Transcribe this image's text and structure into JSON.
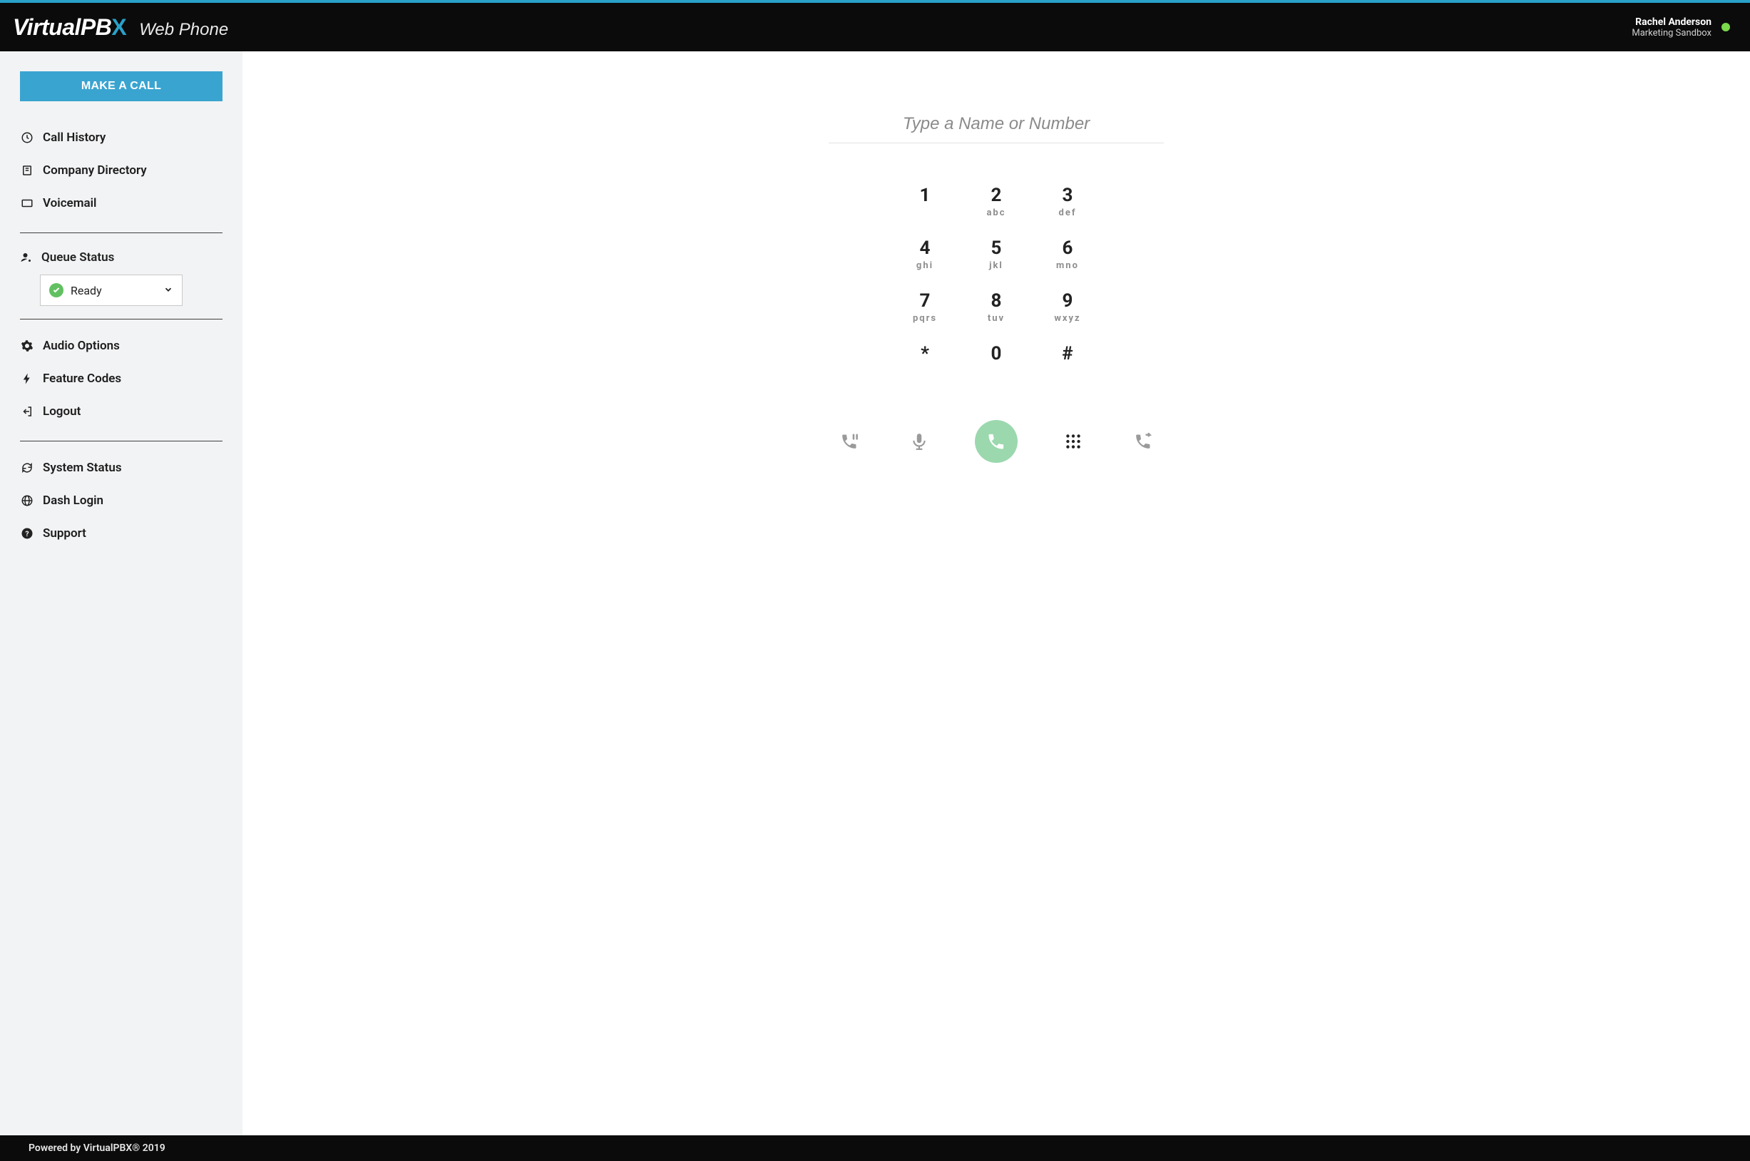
{
  "header": {
    "brand": "VirtualPBX",
    "subtitle": "Web Phone",
    "user_name": "Rachel Anderson",
    "user_org": "Marketing Sandbox",
    "presence_color": "#7bd94a"
  },
  "sidebar": {
    "make_call_label": "MAKE A CALL",
    "nav_primary": [
      {
        "id": "call-history",
        "label": "Call History",
        "icon": "clock-icon"
      },
      {
        "id": "company-directory",
        "label": "Company Directory",
        "icon": "book-icon"
      },
      {
        "id": "voicemail",
        "label": "Voicemail",
        "icon": "voicemail-icon"
      }
    ],
    "queue": {
      "label": "Queue Status",
      "selected": "Ready"
    },
    "nav_secondary": [
      {
        "id": "audio-options",
        "label": "Audio Options",
        "icon": "gear-icon"
      },
      {
        "id": "feature-codes",
        "label": "Feature Codes",
        "icon": "bolt-icon"
      },
      {
        "id": "logout",
        "label": "Logout",
        "icon": "logout-icon"
      }
    ],
    "nav_tertiary": [
      {
        "id": "system-status",
        "label": "System Status",
        "icon": "refresh-icon"
      },
      {
        "id": "dash-login",
        "label": "Dash Login",
        "icon": "globe-icon"
      },
      {
        "id": "support",
        "label": "Support",
        "icon": "help-icon"
      }
    ]
  },
  "dialer": {
    "placeholder": "Type a Name or Number",
    "value": "",
    "keys": [
      {
        "digit": "1",
        "letters": ""
      },
      {
        "digit": "2",
        "letters": "abc"
      },
      {
        "digit": "3",
        "letters": "def"
      },
      {
        "digit": "4",
        "letters": "ghi"
      },
      {
        "digit": "5",
        "letters": "jkl"
      },
      {
        "digit": "6",
        "letters": "mno"
      },
      {
        "digit": "7",
        "letters": "pqrs"
      },
      {
        "digit": "8",
        "letters": "tuv"
      },
      {
        "digit": "9",
        "letters": "wxyz"
      },
      {
        "digit": "*",
        "letters": ""
      },
      {
        "digit": "0",
        "letters": ""
      },
      {
        "digit": "#",
        "letters": ""
      }
    ],
    "actions": {
      "hold": "hold-icon",
      "mute": "mic-icon",
      "call": "phone-icon",
      "keypad": "dialpad-icon",
      "transfer": "transfer-icon"
    }
  },
  "footer": {
    "text": "Powered by VirtualPBX® 2019"
  }
}
